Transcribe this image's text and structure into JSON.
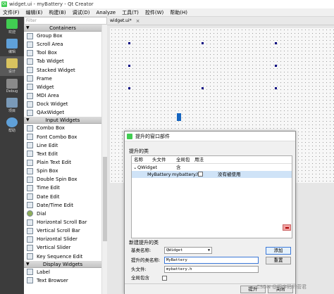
{
  "window": {
    "title": "widget.ui - myBattery - Qt Creator"
  },
  "menu": [
    "文件(F)",
    "编辑(E)",
    "构建(B)",
    "调试(D)",
    "Analyze",
    "工具(T)",
    "控件(W)",
    "帮助(H)"
  ],
  "modes": [
    {
      "label": "欢迎",
      "icon": "qt-logo-icon",
      "color": "#41cd52"
    },
    {
      "label": "编辑",
      "icon": "edit-icon",
      "color": "#5fa0d8"
    },
    {
      "label": "设计",
      "icon": "design-icon",
      "color": "#d8c25f"
    },
    {
      "label": "Debug",
      "icon": "debug-icon",
      "color": "#8a8a8a"
    },
    {
      "label": "项目",
      "icon": "project-icon",
      "color": "#7a9ab8"
    },
    {
      "label": "帮助",
      "icon": "help-icon",
      "color": "#5fa0d8"
    }
  ],
  "filter": {
    "placeholder": "Filter"
  },
  "widgetbox": {
    "containers_title": "Containers",
    "containers": [
      "Group Box",
      "Scroll Area",
      "Tool Box",
      "Tab Widget",
      "Stacked Widget",
      "Frame",
      "Widget",
      "MDI Area",
      "Dock Widget",
      "QAxWidget"
    ],
    "input_title": "Input Widgets",
    "inputs": [
      "Combo Box",
      "Font Combo Box",
      "Line Edit",
      "Text Edit",
      "Plain Text Edit",
      "Spin Box",
      "Double Spin Box",
      "Time Edit",
      "Date Edit",
      "Date/Time Edit",
      "Dial",
      "Horizontal Scroll Bar",
      "Vertical Scroll Bar",
      "Horizontal Slider",
      "Vertical Slider",
      "Key Sequence Edit"
    ],
    "display_title": "Display Widgets",
    "display": [
      "Label",
      "Text Browser"
    ]
  },
  "editor": {
    "tab": "widget.ui*"
  },
  "dialog": {
    "title": "提升的窗口部件",
    "promoted_group": "提升的类",
    "columns": [
      "名称",
      "头文件",
      "全局包含",
      "用法"
    ],
    "tree_parent": "QWidget",
    "tree_child": {
      "name": "MyBattery",
      "header": "mybattery.h",
      "usage": "没有被使用"
    },
    "new_group": "新建提升的类",
    "base_label": "基类名称:",
    "base_value": "QWidget",
    "class_label": "提升的类名称:",
    "class_value": "MyBattery",
    "header_label": "头文件:",
    "header_value": "mybattery.h",
    "global_label": "全局包含",
    "add_button": "添加",
    "reset_button": "重置",
    "promote_button": "提升",
    "close_button": "关闭"
  },
  "watermark": "CSDN @程序码的菅君"
}
